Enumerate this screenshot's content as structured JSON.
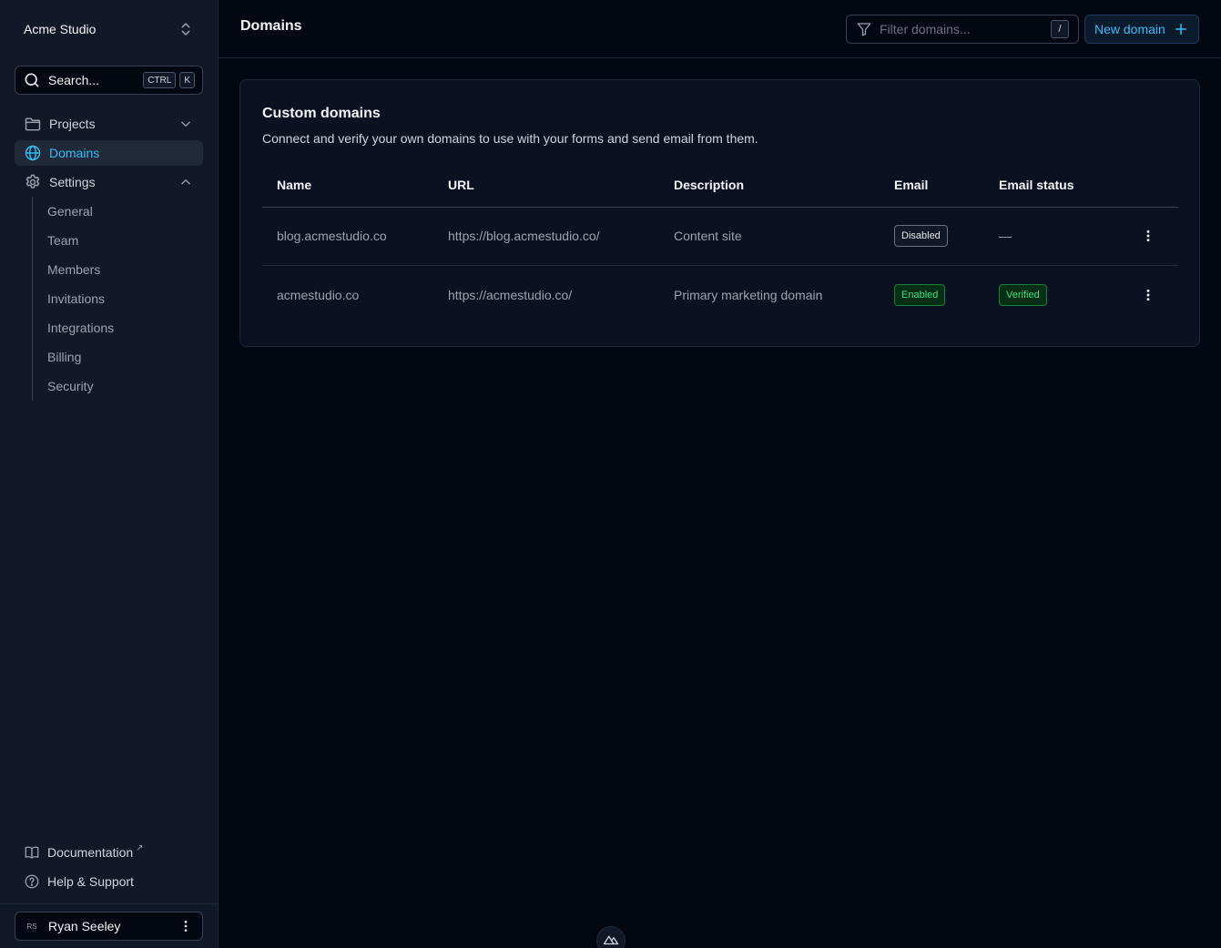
{
  "theme": {
    "accent": "#38bdf8",
    "success": "#4ade80",
    "background": "#030712",
    "sidebar_bg": "#111827"
  },
  "sidebar": {
    "team_name": "Acme Studio",
    "search": {
      "label": "Search...",
      "shortcut_keys": [
        "CTRL",
        "K"
      ]
    },
    "nav": [
      {
        "label": "Projects",
        "icon": "folder-icon"
      },
      {
        "label": "Domains",
        "icon": "globe-icon",
        "active": true
      },
      {
        "label": "Settings",
        "icon": "gear-icon"
      }
    ],
    "settings_items": [
      "General",
      "Team",
      "Members",
      "Invitations",
      "Integrations",
      "Billing",
      "Security"
    ],
    "footer_links": [
      {
        "label": "Documentation",
        "icon": "book-icon",
        "external_mark": "↗"
      },
      {
        "label": "Help & Support",
        "icon": "help-circle-icon"
      }
    ],
    "user": {
      "initials": "RS",
      "name": "Ryan Seeley"
    }
  },
  "header": {
    "title": "Domains",
    "filter": {
      "placeholder": "Filter domains...",
      "shortcut": "/"
    },
    "new_button_label": "New domain"
  },
  "card": {
    "title": "Custom domains",
    "description": "Connect and verify your own domains to use with your forms and send email from them."
  },
  "table": {
    "columns": [
      "Name",
      "URL",
      "Description",
      "Email",
      "Email status"
    ],
    "rows": [
      {
        "name": "blog.acmestudio.co",
        "url": "https://blog.acmestudio.co/",
        "description": "Content site",
        "email": "Disabled",
        "email_status": "—"
      },
      {
        "name": "acmestudio.co",
        "url": "https://acmestudio.co/",
        "description": "Primary marketing domain",
        "email": "Enabled",
        "email_status": "Verified"
      }
    ]
  }
}
